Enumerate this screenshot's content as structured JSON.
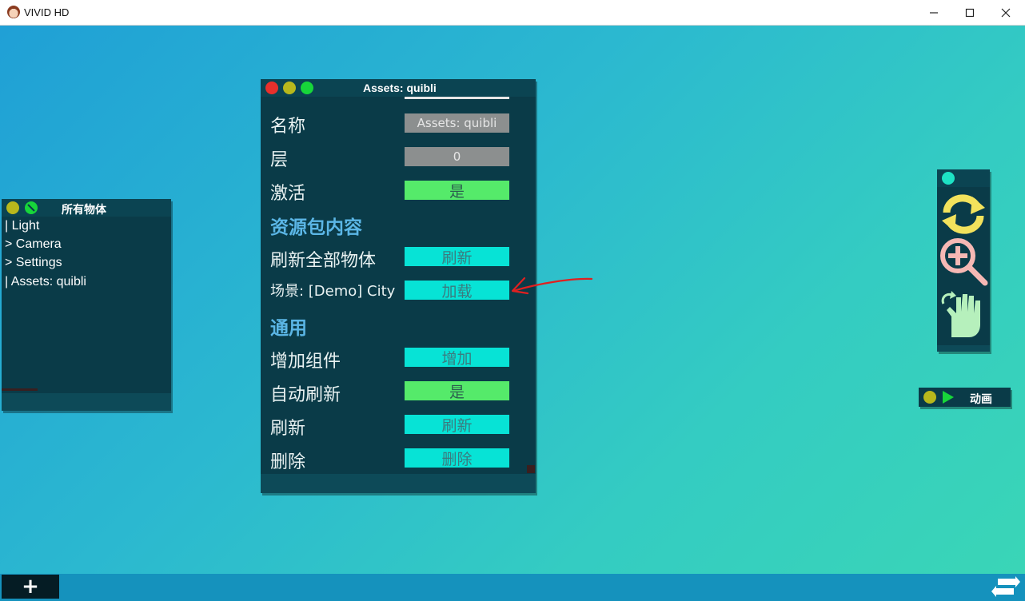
{
  "window": {
    "title": "VIVID HD",
    "minimize": "—",
    "maximize": "☐",
    "close": "✕"
  },
  "hierarchy": {
    "title": "所有物体",
    "items": [
      "| Light",
      "> Camera",
      "> Settings",
      "| Assets: quibli"
    ]
  },
  "inspector": {
    "title": "Assets: quibli",
    "rows": {
      "name_label": "名称",
      "name_value": "Assets: quibli",
      "layer_label": "层",
      "layer_value": "0",
      "active_label": "激活",
      "active_value": "是",
      "section_bundle": "资源包内容",
      "refresh_all_label": "刷新全部物体",
      "refresh_all_button": "刷新",
      "scene_label": "场景: [Demo] City",
      "scene_button": "加载",
      "section_general": "通用",
      "add_component_label": "增加组件",
      "add_component_button": "增加",
      "auto_refresh_label": "自动刷新",
      "auto_refresh_value": "是",
      "refresh_label": "刷新",
      "refresh_button": "刷新",
      "delete_label": "删除",
      "delete_button": "删除"
    }
  },
  "animation": {
    "label": "动画"
  },
  "bottombar": {
    "add": "+"
  },
  "colors": {
    "accent_cyan": "#07e3d6",
    "accent_green": "#55ea6a",
    "panel": "#0a3b48",
    "annotation": "#e02020"
  }
}
